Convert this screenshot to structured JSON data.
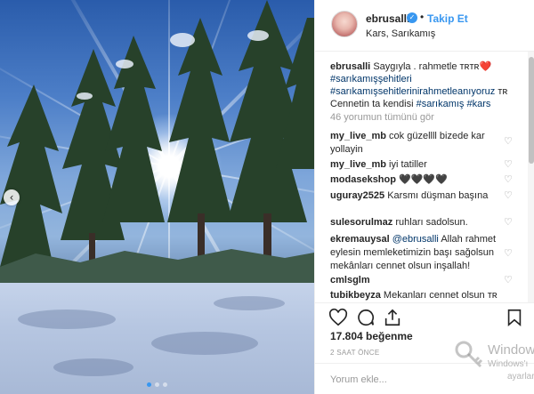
{
  "post": {
    "username": "ebrusalli",
    "verified_icon": "verified-check-icon",
    "separator": "•",
    "follow_label": "Takip Et",
    "location": "Kars, Sarıkamış"
  },
  "caption": {
    "username": "ebrusalli",
    "text_1": "Saygıyla . rahmetle ᴛʀᴛʀ❤️",
    "tag_1": "#sarıkamışşehitleri",
    "tag_2": "#sarıkamışsehitlerinirahmetleanıyoruz",
    "text_2": "ᴛʀ",
    "text_3": "Cennetin ta kendisi",
    "tag_3": "#sarıkamış",
    "tag_4": "#kars"
  },
  "view_all": "46 yorumun tümünü gör",
  "comments": [
    {
      "user": "my_live_mb",
      "text": "cok güzellll bizede kar yollayin"
    },
    {
      "user": "my_live_mb",
      "text": "iyi tatiller"
    },
    {
      "user": "modasekshop",
      "text": "🖤🖤🖤🖤"
    },
    {
      "user": "uguray2525",
      "text": "Karsmı düşman başına"
    },
    {
      "user": "sulesorulmaz",
      "text": "ruhları sadolsun."
    },
    {
      "user": "ekremauysal",
      "mention": "@ebrusalli",
      "text": "Allah rahmet eylesin memleketimizin başı sağolsun mekânları cennet olsun inşallah!"
    },
    {
      "user": "cmlsglm",
      "text": ""
    },
    {
      "user": "tubikbeyza",
      "text": "Mekanları cennet olsun ᴛʀ"
    }
  ],
  "likes": "17.804 beğenme",
  "timestamp": "2 SAAT ÖNCE",
  "add_comment_placeholder": "Yorum ekle...",
  "watermark": {
    "line1": "Window",
    "line2": "Windows'ı",
    "line3": "ayarlarına"
  },
  "carousel": {
    "dots": 3,
    "active_index": 0
  },
  "colors": {
    "accent": "#3897f0",
    "hashtag": "#003569",
    "muted": "#999999"
  }
}
